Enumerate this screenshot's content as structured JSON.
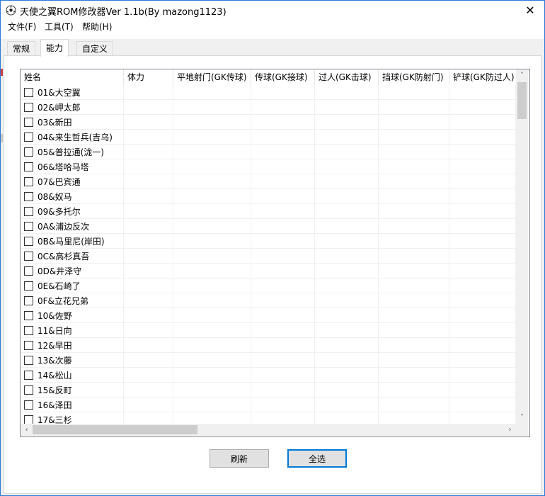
{
  "window": {
    "title": "天使之翼ROM修改器Ver 1.1b(By mazong1123)",
    "close_glyph": "✕"
  },
  "menu": [
    {
      "label": "文件(F)"
    },
    {
      "label": "工具(T)"
    },
    {
      "label": "帮助(H)"
    }
  ],
  "tabs": [
    {
      "label": "常规",
      "active": false
    },
    {
      "label": "能力",
      "active": true
    },
    {
      "label": "自定义",
      "active": false
    }
  ],
  "table": {
    "columns": [
      {
        "label": "姓名"
      },
      {
        "label": "体力"
      },
      {
        "label": "平地射门(GK传球)"
      },
      {
        "label": "传球(GK接球)"
      },
      {
        "label": "过人(GK击球)"
      },
      {
        "label": "挡球(GK防射门)"
      },
      {
        "label": "铲球(GK防过人)"
      }
    ],
    "rows": [
      {
        "name": "01&大空翼",
        "checked": false
      },
      {
        "name": "02&岬太郎",
        "checked": false
      },
      {
        "name": "03&新田",
        "checked": false
      },
      {
        "name": "04&来生哲兵(吉乌)",
        "checked": false
      },
      {
        "name": "05&普拉通(泷一)",
        "checked": false
      },
      {
        "name": "06&塔哈马塔",
        "checked": false
      },
      {
        "name": "07&巴宾通",
        "checked": false
      },
      {
        "name": "08&奴马",
        "checked": false
      },
      {
        "name": "09&多托尔",
        "checked": false
      },
      {
        "name": "0A&浦边反次",
        "checked": false
      },
      {
        "name": "0B&马里尼(岸田)",
        "checked": false
      },
      {
        "name": "0C&高杉真吾",
        "checked": false
      },
      {
        "name": "0D&井泽守",
        "checked": false
      },
      {
        "name": "0E&石崎了",
        "checked": false
      },
      {
        "name": "0F&立花兄弟",
        "checked": false
      },
      {
        "name": "10&佐野",
        "checked": false
      },
      {
        "name": "11&日向",
        "checked": false
      },
      {
        "name": "12&早田",
        "checked": false
      },
      {
        "name": "13&次藤",
        "checked": false
      },
      {
        "name": "14&松山",
        "checked": false
      },
      {
        "name": "15&反町",
        "checked": false
      },
      {
        "name": "16&泽田",
        "checked": false
      },
      {
        "name": "17&三杉",
        "checked": false
      }
    ]
  },
  "scroll": {
    "up": "˄",
    "down": "˅",
    "left": "‹",
    "right": "›"
  },
  "buttons": {
    "refresh": "刷新",
    "select_all": "全选"
  }
}
